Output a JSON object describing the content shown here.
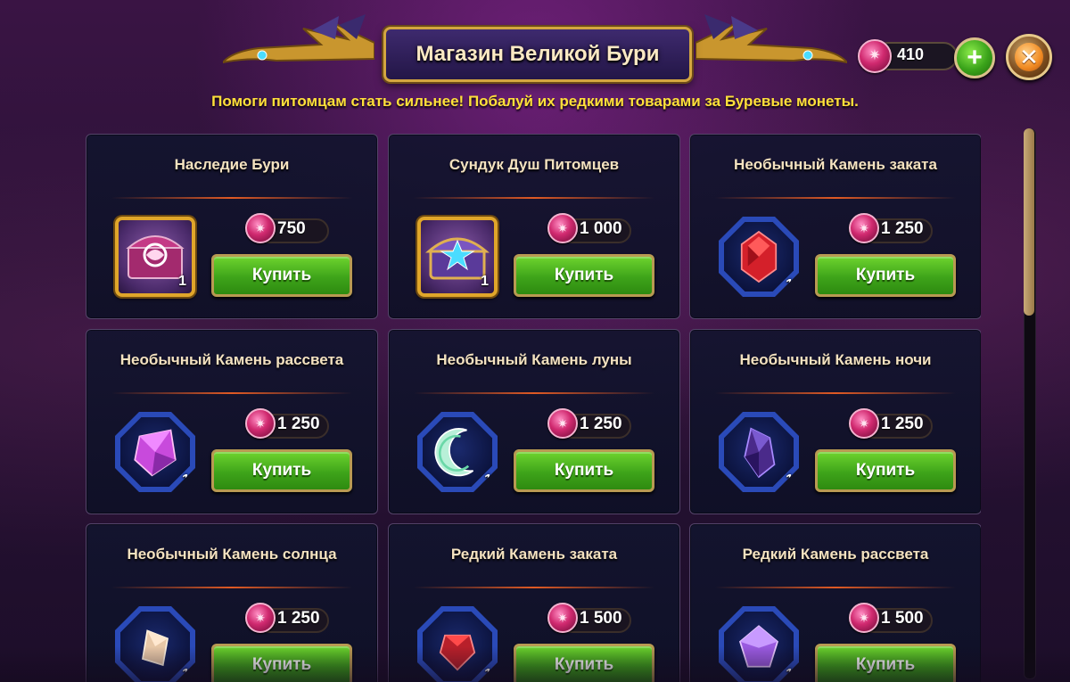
{
  "header": {
    "title": "Магазин Великой Бури",
    "subtitle": "Помоги питомцам стать сильнее! Побалуй их редкими товарами за Буревые монеты."
  },
  "currency": {
    "icon": "storm-coin-icon",
    "amount": "410",
    "add_icon": "plus-icon",
    "close_icon": "close-icon"
  },
  "colors": {
    "accent_gold": "#d4a640",
    "buy_green": "#3ea41a",
    "subtitle_yellow": "#ffe03a",
    "coin_pink": "#d0296f"
  },
  "shop": {
    "buy_label": "Купить",
    "items": [
      {
        "title": "Наследие Бури",
        "price": "750",
        "count": "1",
        "icon": "storm-legacy-chest-icon",
        "frame": "square"
      },
      {
        "title": "Сундук Душ Питомцев",
        "price": "1 000",
        "count": "1",
        "icon": "pet-soul-chest-icon",
        "frame": "square"
      },
      {
        "title": "Необычный Камень заката",
        "price": "1 250",
        "count": "1",
        "icon": "red-gem-icon",
        "frame": "hex"
      },
      {
        "title": "Необычный Камень рассвета",
        "price": "1 250",
        "count": "1",
        "icon": "pink-gem-icon",
        "frame": "hex"
      },
      {
        "title": "Необычный Камень луны",
        "price": "1 250",
        "count": "1",
        "icon": "moon-gem-icon",
        "frame": "hex"
      },
      {
        "title": "Необычный Камень ночи",
        "price": "1 250",
        "count": "1",
        "icon": "dark-crystal-icon",
        "frame": "hex"
      },
      {
        "title": "Необычный Камень солнца",
        "price": "1 250",
        "count": "1",
        "icon": "sun-gem-icon",
        "frame": "hex"
      },
      {
        "title": "Редкий Камень заката",
        "price": "1 500",
        "count": "1",
        "icon": "rare-red-gem-icon",
        "frame": "hex"
      },
      {
        "title": "Редкий Камень рассвета",
        "price": "1 500",
        "count": "1",
        "icon": "rare-pink-gem-icon",
        "frame": "hex"
      }
    ]
  }
}
